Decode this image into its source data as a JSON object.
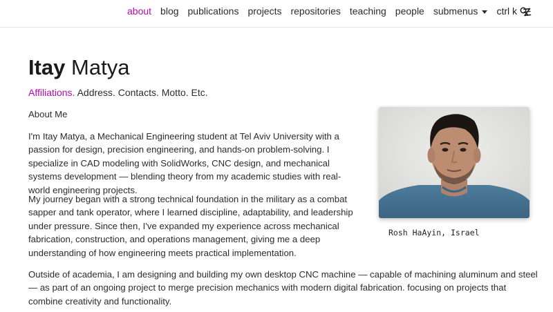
{
  "nav": {
    "items": [
      {
        "label": "about",
        "active": true
      },
      {
        "label": "blog",
        "active": false
      },
      {
        "label": "publications",
        "active": false
      },
      {
        "label": "projects",
        "active": false
      },
      {
        "label": "repositories",
        "active": false
      },
      {
        "label": "teaching",
        "active": false
      },
      {
        "label": "people",
        "active": false
      }
    ],
    "submenus_label": "submenus",
    "search_label": "ctrl k",
    "search_icon": "magnifier-icon",
    "theme_icon": "theme-toggle-icon"
  },
  "header": {
    "first_name": "Itay",
    "last_name": " Matya"
  },
  "subtitle": {
    "link": "Affiliations.",
    "rest": " Address. Contacts. Motto. Etc."
  },
  "content": {
    "about_heading": "About Me",
    "paragraphs": [
      "I'm Itay Matya, a Mechanical Engineering student at Tel Aviv University with a passion for design, precision engineering, and hands-on problem-solving. I specialize in CAD modeling with SolidWorks, CNC design, and mechanical systems development — blending theory from my academic studies with real-world engineering projects.",
      "My journey began with a strong technical foundation in the military as a combat sapper and tank operator, where I learned discipline, adaptability, and leadership under pressure. Since then, I've expanded my experience across mechanical fabrication, construction, and operations management, giving me a deep understanding of how engineering meets practical implementation.",
      "Outside of academia, I am designing and building my own desktop CNC machine — capable of machining aluminum and steel — as part of an ongoing project to merge precision mechanics with modern digital fabrication. focusing on projects that combine creativity and functionality."
    ]
  },
  "profile": {
    "caption": "Rosh HaAyin, Israel"
  },
  "colors": {
    "accent": "#b509ac",
    "text": "#2b2b2b",
    "divider": "#e6e6e6"
  }
}
